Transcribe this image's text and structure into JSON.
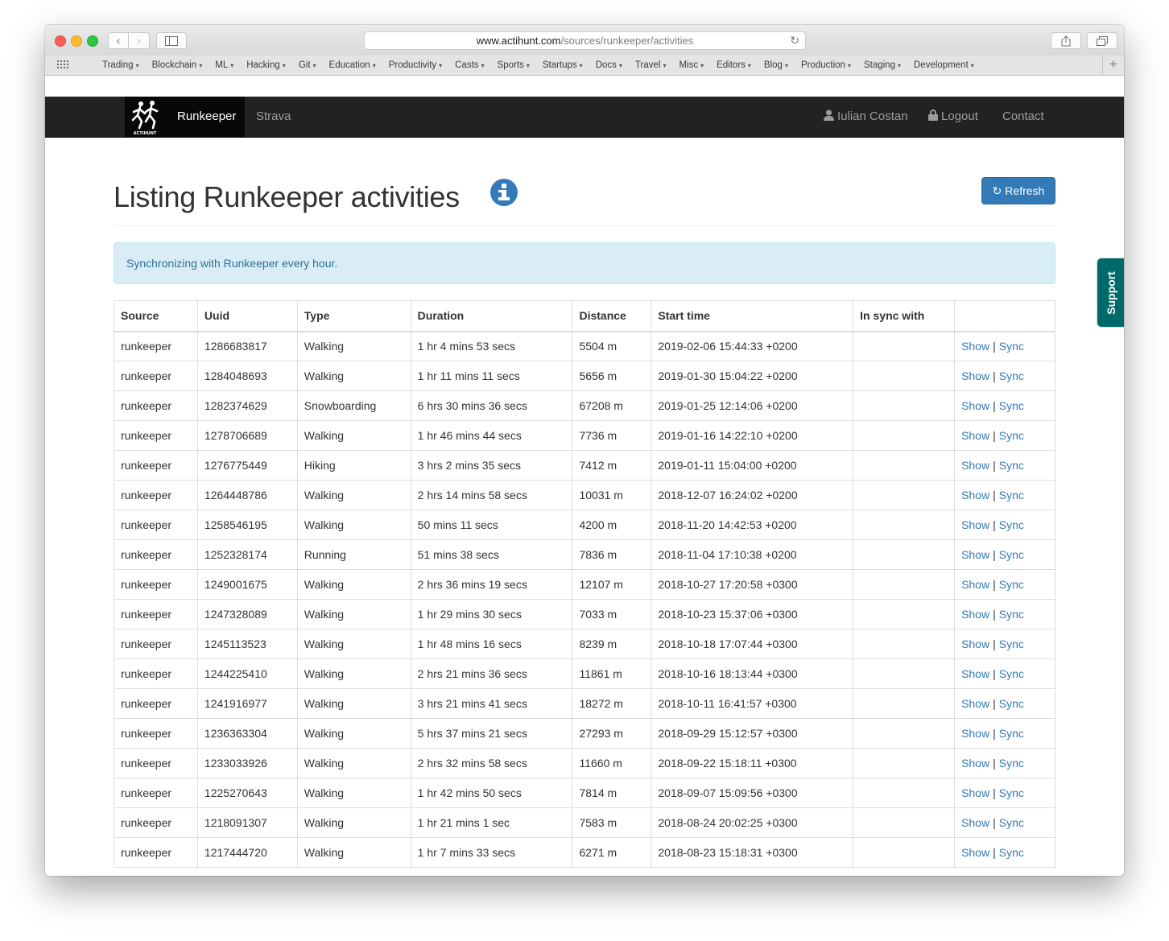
{
  "browser": {
    "url_domain": "www.actihunt.com",
    "url_path": "/sources/runkeeper/activities",
    "bookmarks": [
      "Trading",
      "Blockchain",
      "ML",
      "Hacking",
      "Git",
      "Education",
      "Productivity",
      "Casts",
      "Sports",
      "Startups",
      "Docs",
      "Travel",
      "Misc",
      "Editors",
      "Blog",
      "Production",
      "Staging",
      "Development"
    ]
  },
  "navbar": {
    "brand": "Runkeeper",
    "logo_text": "ACTIHUNT",
    "strava": "Strava",
    "user": "Iulian Costan",
    "logout": "Logout",
    "contact": "Contact"
  },
  "page": {
    "title": "Listing Runkeeper activities",
    "refresh_label": "Refresh",
    "alert": "Synchronizing with Runkeeper every hour.",
    "support": "Support"
  },
  "table": {
    "headers": [
      "Source",
      "Uuid",
      "Type",
      "Duration",
      "Distance",
      "Start time",
      "In sync with",
      ""
    ],
    "show_label": "Show",
    "sync_label": "Sync",
    "rows": [
      {
        "source": "runkeeper",
        "uuid": "1286683817",
        "type": "Walking",
        "duration": "1 hr 4 mins 53 secs",
        "distance": "5504 m",
        "start": "2019-02-06 15:44:33 +0200",
        "sync": ""
      },
      {
        "source": "runkeeper",
        "uuid": "1284048693",
        "type": "Walking",
        "duration": "1 hr 11 mins 11 secs",
        "distance": "5656 m",
        "start": "2019-01-30 15:04:22 +0200",
        "sync": ""
      },
      {
        "source": "runkeeper",
        "uuid": "1282374629",
        "type": "Snowboarding",
        "duration": "6 hrs 30 mins 36 secs",
        "distance": "67208 m",
        "start": "2019-01-25 12:14:06 +0200",
        "sync": ""
      },
      {
        "source": "runkeeper",
        "uuid": "1278706689",
        "type": "Walking",
        "duration": "1 hr 46 mins 44 secs",
        "distance": "7736 m",
        "start": "2019-01-16 14:22:10 +0200",
        "sync": ""
      },
      {
        "source": "runkeeper",
        "uuid": "1276775449",
        "type": "Hiking",
        "duration": "3 hrs 2 mins 35 secs",
        "distance": "7412 m",
        "start": "2019-01-11 15:04:00 +0200",
        "sync": ""
      },
      {
        "source": "runkeeper",
        "uuid": "1264448786",
        "type": "Walking",
        "duration": "2 hrs 14 mins 58 secs",
        "distance": "10031 m",
        "start": "2018-12-07 16:24:02 +0200",
        "sync": ""
      },
      {
        "source": "runkeeper",
        "uuid": "1258546195",
        "type": "Walking",
        "duration": "50 mins 11 secs",
        "distance": "4200 m",
        "start": "2018-11-20 14:42:53 +0200",
        "sync": ""
      },
      {
        "source": "runkeeper",
        "uuid": "1252328174",
        "type": "Running",
        "duration": "51 mins 38 secs",
        "distance": "7836 m",
        "start": "2018-11-04 17:10:38 +0200",
        "sync": ""
      },
      {
        "source": "runkeeper",
        "uuid": "1249001675",
        "type": "Walking",
        "duration": "2 hrs 36 mins 19 secs",
        "distance": "12107 m",
        "start": "2018-10-27 17:20:58 +0300",
        "sync": ""
      },
      {
        "source": "runkeeper",
        "uuid": "1247328089",
        "type": "Walking",
        "duration": "1 hr 29 mins 30 secs",
        "distance": "7033 m",
        "start": "2018-10-23 15:37:06 +0300",
        "sync": ""
      },
      {
        "source": "runkeeper",
        "uuid": "1245113523",
        "type": "Walking",
        "duration": "1 hr 48 mins 16 secs",
        "distance": "8239 m",
        "start": "2018-10-18 17:07:44 +0300",
        "sync": ""
      },
      {
        "source": "runkeeper",
        "uuid": "1244225410",
        "type": "Walking",
        "duration": "2 hrs 21 mins 36 secs",
        "distance": "11861 m",
        "start": "2018-10-16 18:13:44 +0300",
        "sync": ""
      },
      {
        "source": "runkeeper",
        "uuid": "1241916977",
        "type": "Walking",
        "duration": "3 hrs 21 mins 41 secs",
        "distance": "18272 m",
        "start": "2018-10-11 16:41:57 +0300",
        "sync": ""
      },
      {
        "source": "runkeeper",
        "uuid": "1236363304",
        "type": "Walking",
        "duration": "5 hrs 37 mins 21 secs",
        "distance": "27293 m",
        "start": "2018-09-29 15:12:57 +0300",
        "sync": ""
      },
      {
        "source": "runkeeper",
        "uuid": "1233033926",
        "type": "Walking",
        "duration": "2 hrs 32 mins 58 secs",
        "distance": "11660 m",
        "start": "2018-09-22 15:18:11 +0300",
        "sync": ""
      },
      {
        "source": "runkeeper",
        "uuid": "1225270643",
        "type": "Walking",
        "duration": "1 hr 42 mins 50 secs",
        "distance": "7814 m",
        "start": "2018-09-07 15:09:56 +0300",
        "sync": ""
      },
      {
        "source": "runkeeper",
        "uuid": "1218091307",
        "type": "Walking",
        "duration": "1 hr 21 mins 1 sec",
        "distance": "7583 m",
        "start": "2018-08-24 20:02:25 +0300",
        "sync": ""
      },
      {
        "source": "runkeeper",
        "uuid": "1217444720",
        "type": "Walking",
        "duration": "1 hr 7 mins 33 secs",
        "distance": "6271 m",
        "start": "2018-08-23 15:18:31 +0300",
        "sync": ""
      }
    ]
  },
  "colors": {
    "navbar_bg": "#222222",
    "link": "#337ab7",
    "alert_bg": "#d9edf7",
    "support_bg": "#006a6a"
  }
}
